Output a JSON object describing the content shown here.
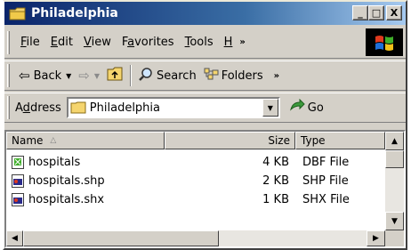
{
  "window": {
    "title": "Philadelphia"
  },
  "title_buttons": {
    "minimize": "_",
    "maximize": "□",
    "close": "X"
  },
  "menu": {
    "items": [
      {
        "label": "File",
        "accel": "F",
        "rest": "ile"
      },
      {
        "label": "Edit",
        "accel": "E",
        "rest": "dit"
      },
      {
        "label": "View",
        "accel": "V",
        "rest": "iew"
      },
      {
        "label": "Favorites",
        "pre": "F",
        "accel": "a",
        "rest": "vorites"
      },
      {
        "label": "Tools",
        "accel": "T",
        "rest": "ools"
      },
      {
        "label": "H",
        "accel": "H",
        "rest": ""
      }
    ],
    "more": "»"
  },
  "toolbar": {
    "back": "Back",
    "search": "Search",
    "folders": "Folders",
    "more": "»"
  },
  "address": {
    "label": "Address",
    "accel": "d",
    "value": "Philadelphia",
    "go": "Go"
  },
  "list": {
    "columns": [
      "Name",
      "Size",
      "Type"
    ],
    "rows": [
      {
        "name": "hospitals",
        "size": "4 KB",
        "type": "DBF File",
        "icon": "dbf-file-icon"
      },
      {
        "name": "hospitals.shp",
        "size": "2 KB",
        "type": "SHP File",
        "icon": "shp-file-icon"
      },
      {
        "name": "hospitals.shx",
        "size": "1 KB",
        "type": "SHX File",
        "icon": "shx-file-icon"
      }
    ]
  }
}
